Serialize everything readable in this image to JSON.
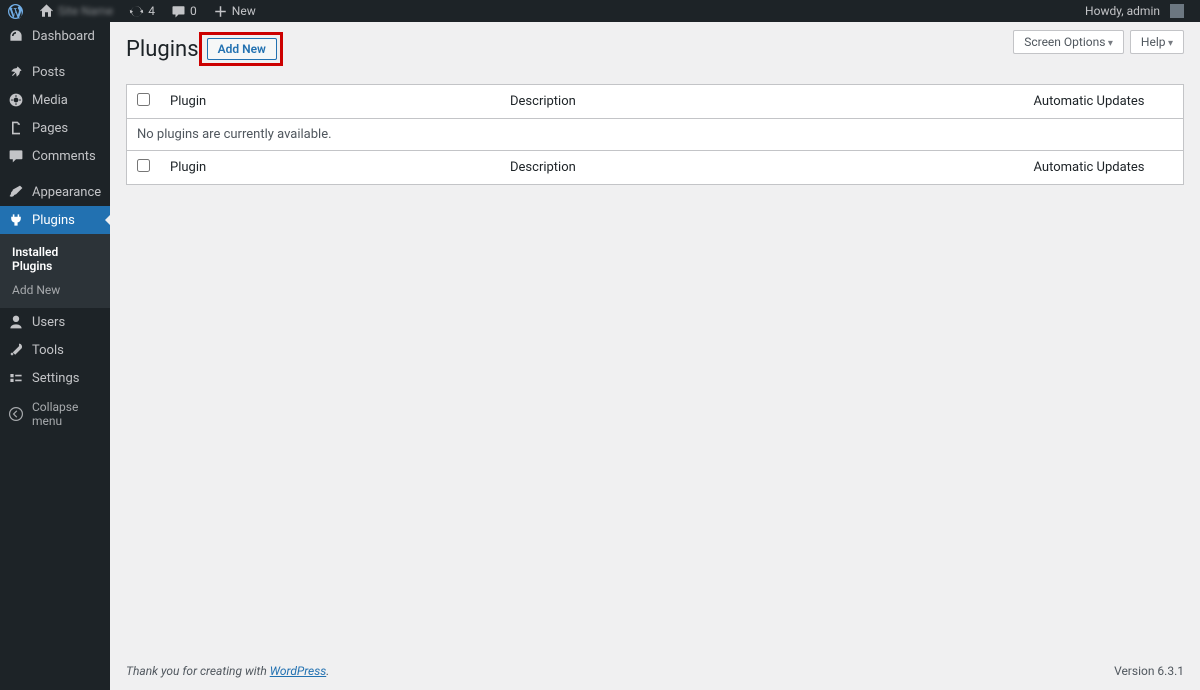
{
  "adminbar": {
    "site_name": "Site Name",
    "updates_count": "4",
    "comments_count": "0",
    "new_label": "New",
    "howdy": "Howdy, admin"
  },
  "sidebar": {
    "items": [
      {
        "label": "Dashboard"
      },
      {
        "label": "Posts"
      },
      {
        "label": "Media"
      },
      {
        "label": "Pages"
      },
      {
        "label": "Comments"
      },
      {
        "label": "Appearance"
      },
      {
        "label": "Plugins"
      },
      {
        "label": "Users"
      },
      {
        "label": "Tools"
      },
      {
        "label": "Settings"
      }
    ],
    "submenu": {
      "installed": "Installed Plugins",
      "add_new": "Add New"
    },
    "collapse": "Collapse menu"
  },
  "topbuttons": {
    "screen_options": "Screen Options",
    "help": "Help"
  },
  "page": {
    "title": "Plugins",
    "add_new": "Add New"
  },
  "table": {
    "col_plugin": "Plugin",
    "col_description": "Description",
    "col_auto": "Automatic Updates",
    "empty": "No plugins are currently available."
  },
  "footer": {
    "thanks_pre": "Thank you for creating with ",
    "thanks_link": "WordPress",
    "thanks_post": ".",
    "version": "Version 6.3.1"
  }
}
